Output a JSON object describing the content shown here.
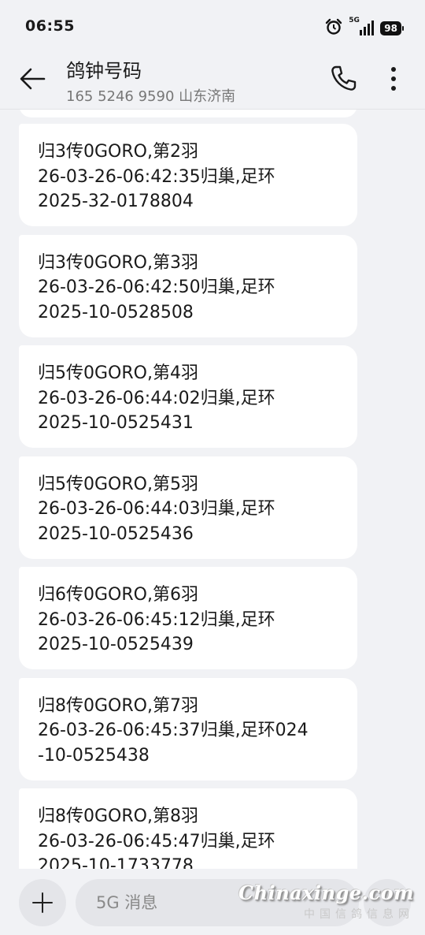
{
  "status_bar": {
    "time": "06:55",
    "network_label": "5G",
    "battery": "98",
    "icons": [
      "alarm-icon",
      "signal-icon",
      "battery-icon"
    ]
  },
  "header": {
    "title": "鸽钟号码",
    "phone_location": "165 5246 9590  山东济南",
    "icons": [
      "back-arrow-icon",
      "phone-icon",
      "more-vert-icon"
    ]
  },
  "messages": [
    {
      "lines": [
        "归3传0GORO,第2羽",
        "26-03-26-06:42:35归巢,足环",
        "2025-32-0178804"
      ]
    },
    {
      "lines": [
        "归3传0GORO,第3羽",
        "26-03-26-06:42:50归巢,足环",
        "2025-10-0528508"
      ]
    },
    {
      "lines": [
        "归5传0GORO,第4羽",
        "26-03-26-06:44:02归巢,足环",
        "2025-10-0525431"
      ]
    },
    {
      "lines": [
        "归5传0GORO,第5羽",
        "26-03-26-06:44:03归巢,足环",
        "2025-10-0525436"
      ]
    },
    {
      "lines": [
        "归6传0GORO,第6羽",
        "26-03-26-06:45:12归巢,足环",
        "2025-10-0525439"
      ]
    },
    {
      "lines": [
        "归8传0GORO,第7羽",
        "26-03-26-06:45:37归巢,足环024",
        "-10-0525438"
      ]
    },
    {
      "lines": [
        "归8传0GORO,第8羽",
        "26-03-26-06:45:47归巢,足环",
        "2025-10-1733778"
      ]
    }
  ],
  "composer": {
    "placeholder": "5G 消息",
    "icons": [
      "add-icon",
      "send-icon"
    ]
  },
  "watermark": {
    "main": "Chinaxinge.com",
    "sub": "中国信鸽信息网"
  },
  "colors": {
    "background": "#f1f2f5",
    "bubble": "#ffffff",
    "text": "#1a1a1a",
    "secondary_text": "#777777"
  }
}
